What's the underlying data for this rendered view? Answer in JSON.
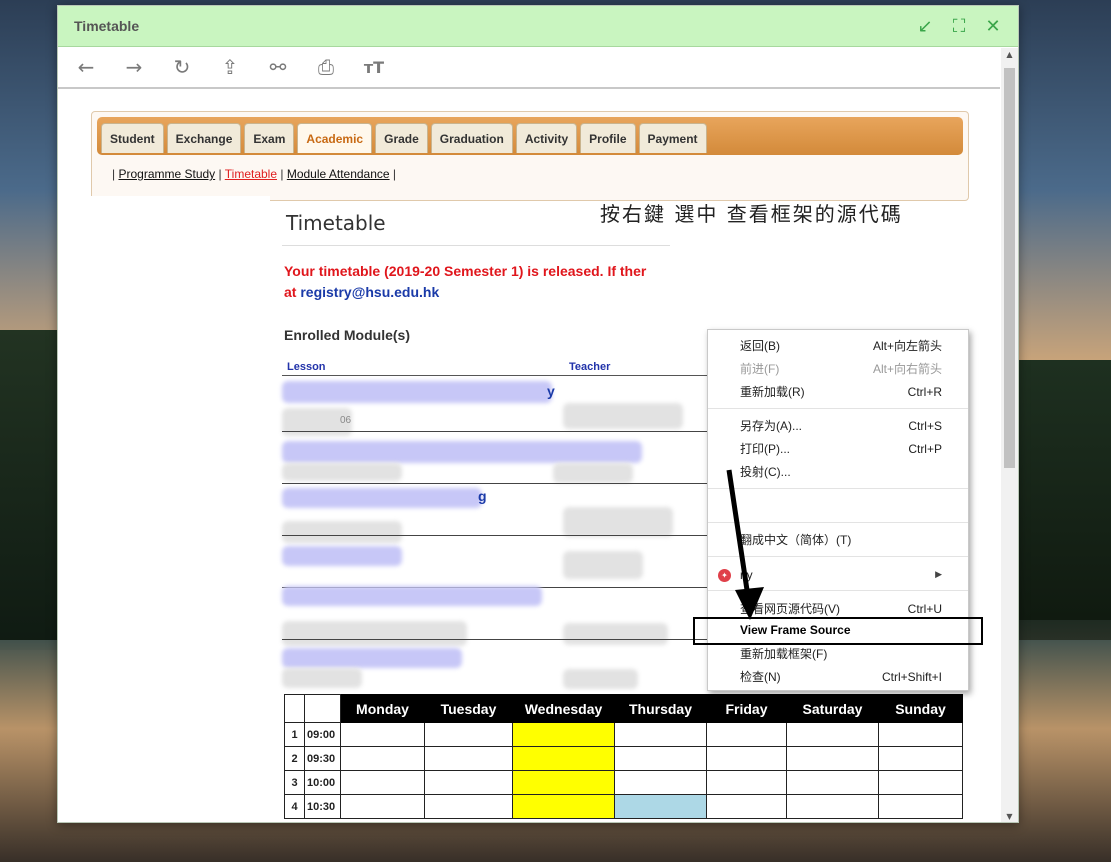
{
  "window": {
    "title": "Timetable",
    "controls": {
      "minimize_icon": "↙",
      "maximize_icon": "⛶",
      "close_icon": "✕"
    }
  },
  "toolbar": {
    "icons": [
      "back-icon",
      "forward-icon",
      "reload-icon",
      "open-external-icon",
      "link-icon",
      "print-icon",
      "text-size-icon"
    ]
  },
  "nav": {
    "tabs": [
      {
        "label": "Student",
        "active": false
      },
      {
        "label": "Exchange",
        "active": false
      },
      {
        "label": "Exam",
        "active": false
      },
      {
        "label": "Academic",
        "active": true
      },
      {
        "label": "Grade",
        "active": false
      },
      {
        "label": "Graduation",
        "active": false
      },
      {
        "label": "Activity",
        "active": false
      },
      {
        "label": "Profile",
        "active": false
      },
      {
        "label": "Payment",
        "active": false
      }
    ],
    "sublinks": [
      {
        "label": "Programme Study",
        "active": false
      },
      {
        "label": "Timetable",
        "active": true
      },
      {
        "label": "Module Attendance",
        "active": false
      }
    ],
    "separator": "|"
  },
  "page": {
    "title": "Timetable",
    "notice_line1": "Your timetable (2019-20 Semester 1) is released. If ther",
    "notice_line2_prefix": "at ",
    "notice_email": "registry@hsu.edu.hk",
    "enrolled_heading": "Enrolled Module(s)",
    "col_lesson": "Lesson",
    "col_teacher": "Teacher",
    "fragment_y": "y",
    "fragment_g": "g",
    "fragment_06": "06"
  },
  "annotation": "按右鍵 選中 查看框架的源代碼",
  "timetable": {
    "days": [
      "Monday",
      "Tuesday",
      "Wednesday",
      "Thursday",
      "Friday",
      "Saturday",
      "Sunday"
    ],
    "rows": [
      {
        "idx": "1",
        "time": "09:00"
      },
      {
        "idx": "2",
        "time": "09:30"
      },
      {
        "idx": "3",
        "time": "10:00"
      },
      {
        "idx": "4",
        "time": "10:30"
      }
    ]
  },
  "context_menu": {
    "items": [
      {
        "label": "返回(B)",
        "shortcut": "Alt+向左箭头",
        "disabled": false
      },
      {
        "label": "前进(F)",
        "shortcut": "Alt+向右箭头",
        "disabled": true
      },
      {
        "label": "重新加载(R)",
        "shortcut": "Ctrl+R",
        "disabled": false
      },
      {
        "label": "另存为(A)...",
        "shortcut": "Ctrl+S",
        "disabled": false
      },
      {
        "label": "打印(P)...",
        "shortcut": "Ctrl+P",
        "disabled": false
      },
      {
        "label": "投射(C)...",
        "shortcut": "",
        "disabled": false
      },
      {
        "label": "翻成中文（简体）(T)",
        "shortcut": "",
        "disabled": false
      },
      {
        "label": "ny",
        "shortcut": "▶",
        "disabled": false
      },
      {
        "label": "查看网页源代码(V)",
        "shortcut": "Ctrl+U",
        "disabled": false
      },
      {
        "label": "View Frame Source",
        "shortcut": "",
        "disabled": false
      },
      {
        "label": "重新加载框架(F)",
        "shortcut": "",
        "disabled": false
      },
      {
        "label": "检查(N)",
        "shortcut": "Ctrl+Shift+I",
        "disabled": false
      }
    ]
  }
}
